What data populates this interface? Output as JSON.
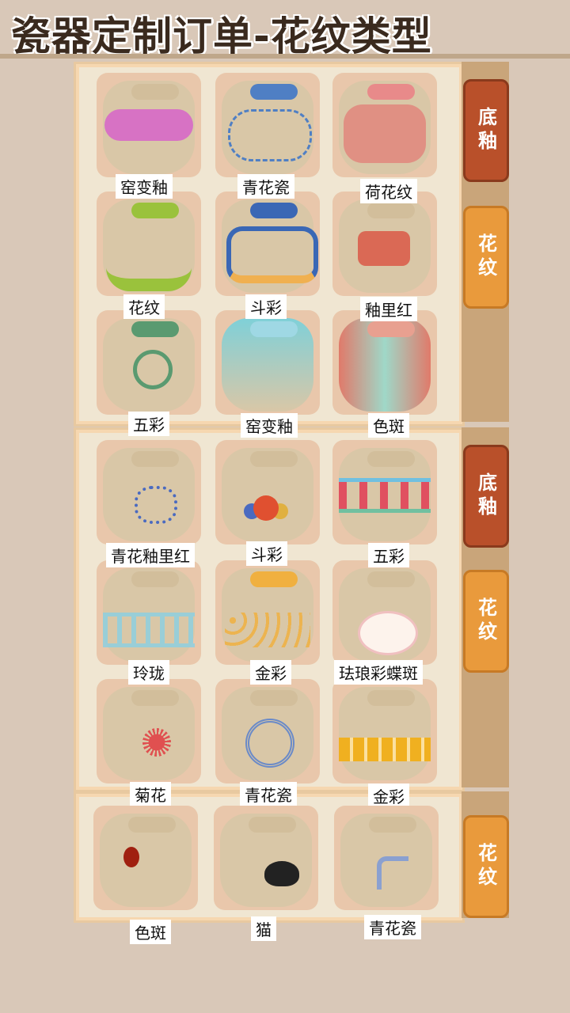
{
  "header": {
    "title": "瓷器定制订单-花纹类型"
  },
  "tabs": {
    "base_glaze": "底釉",
    "pattern": "花纹"
  },
  "sections": [
    {
      "items": [
        {
          "label": "窑变釉",
          "color": "#d64fd0",
          "icon": "purple-glaze-vase-icon"
        },
        {
          "label": "青花瓷",
          "color": "#4f7fc4",
          "icon": "blue-white-vase-icon"
        },
        {
          "label": "荷花纹",
          "color": "#e46a6a",
          "icon": "lotus-pattern-vase-icon"
        },
        {
          "label": "花纹",
          "color": "#9ac23c",
          "icon": "floral-vase-icon"
        },
        {
          "label": "斗彩",
          "color": "#3a67b5",
          "icon": "doucai-vase-icon"
        },
        {
          "label": "釉里红",
          "color": "#d94a3a",
          "icon": "underglaze-red-vase-icon"
        },
        {
          "label": "五彩",
          "color": "#5a9a70",
          "icon": "wucai-vase-icon"
        },
        {
          "label": "窑变釉",
          "color": "#7fd0d8",
          "icon": "blue-gradient-vase-icon"
        },
        {
          "label": "色斑",
          "color": "#e07a6a",
          "icon": "color-spot-vase-icon"
        }
      ]
    },
    {
      "items": [
        {
          "label": "青花釉里红",
          "color": "#4a6ac0",
          "icon": "blue-red-motif-icon"
        },
        {
          "label": "斗彩",
          "color": "#e05030",
          "icon": "doucai-flower-motif-icon"
        },
        {
          "label": "五彩",
          "color": "#70c0a0",
          "icon": "wucai-band-motif-icon"
        },
        {
          "label": "玲珑",
          "color": "#8fd0e0",
          "icon": "linglong-band-motif-icon"
        },
        {
          "label": "金彩",
          "color": "#f0b040",
          "icon": "gold-scroll-motif-icon"
        },
        {
          "label": "珐琅彩蝶斑",
          "color": "#f0c0c0",
          "icon": "enamel-butterfly-motif-icon"
        },
        {
          "label": "菊花",
          "color": "#e05050",
          "icon": "chrysanthemum-motif-icon"
        },
        {
          "label": "青花瓷",
          "color": "#6a8ac8",
          "icon": "blue-medallion-motif-icon"
        },
        {
          "label": "金彩",
          "color": "#f0b020",
          "icon": "gold-band-motif-icon"
        }
      ]
    },
    {
      "items": [
        {
          "label": "色斑",
          "color": "#a02010",
          "icon": "spot-motif-icon"
        },
        {
          "label": "猫",
          "color": "#222222",
          "icon": "cat-motif-icon"
        },
        {
          "label": "青花瓷",
          "color": "#8aa0d0",
          "icon": "blue-branch-motif-icon"
        }
      ]
    }
  ]
}
